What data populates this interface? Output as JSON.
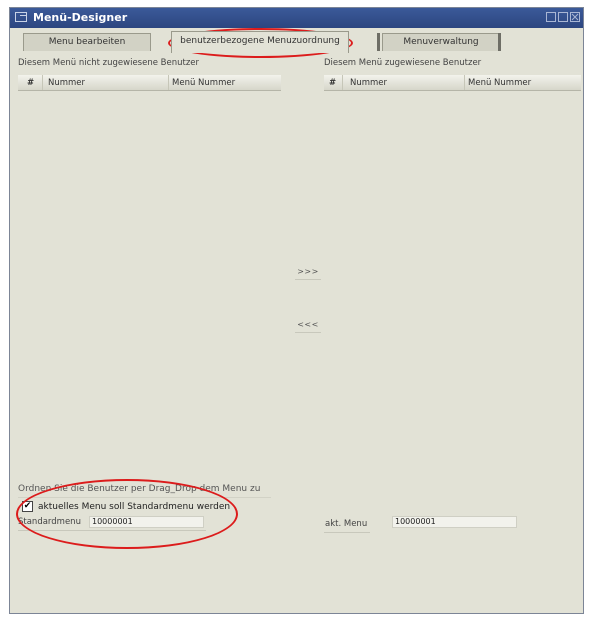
{
  "window": {
    "title": "Menü-Designer"
  },
  "tabs": [
    {
      "label": "Menu bearbeiten"
    },
    {
      "label": "benutzerbezogene Menuzuordnung"
    },
    {
      "label": "Menuverwaltung"
    }
  ],
  "left_panel": {
    "label": "Diesem Menü nicht zugewiesene Benutzer",
    "columns": [
      "#",
      "Nummer",
      "Menü Nummer"
    ],
    "rows": []
  },
  "right_panel": {
    "label": "Diesem Menü zugewiesene Benutzer",
    "columns": [
      "#",
      "Nummer",
      "Menü Nummer"
    ],
    "rows": []
  },
  "buttons": {
    "assign": ">>>",
    "unassign": "<<<"
  },
  "hint": "Ordnen Sie die Benutzer per Drag_Drop dem Menu zu",
  "default_checkbox": {
    "label": "aktuelles Menu soll Standardmenu werden",
    "checked": true,
    "mark": "✔"
  },
  "standardmenu": {
    "label": "Standardmenu",
    "value": "10000001"
  },
  "current_menu": {
    "label": "akt. Menu",
    "value": "10000001"
  },
  "colors": {
    "titlebar": "#2f4b86",
    "annotation": "#dc1c1c",
    "panel": "#e2e2d6"
  }
}
